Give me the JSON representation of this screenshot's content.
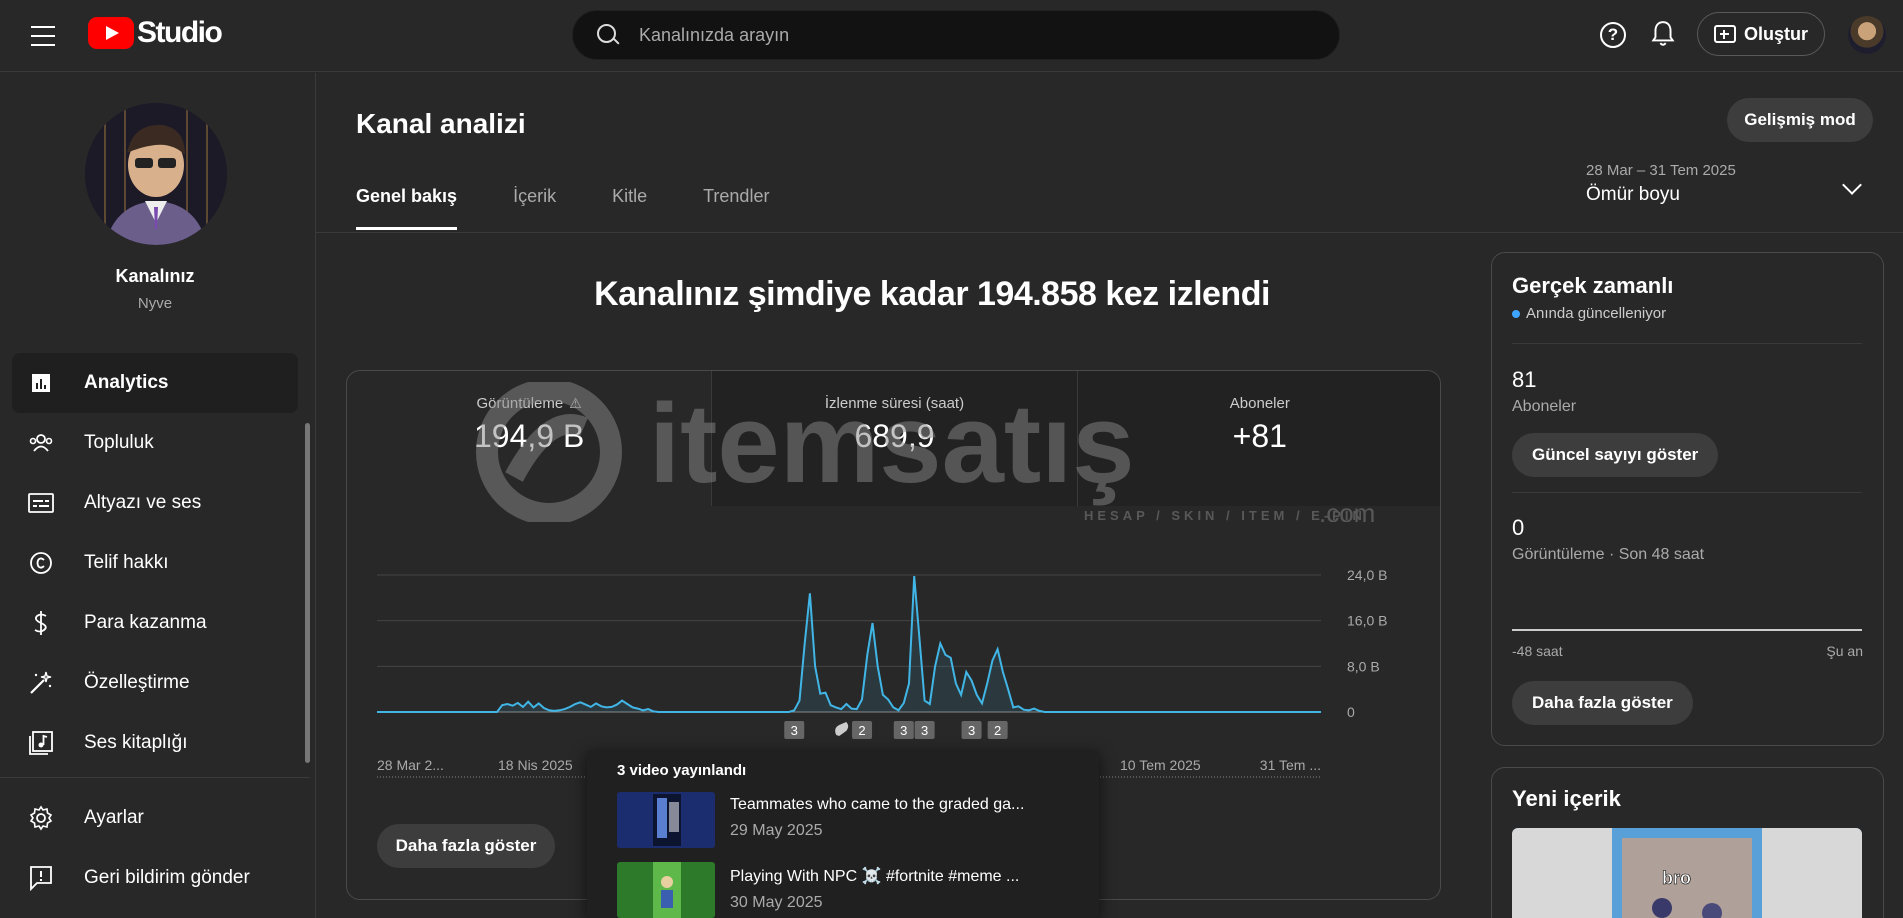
{
  "app": {
    "logo_text": "Studio"
  },
  "search": {
    "placeholder": "Kanalınızda arayın"
  },
  "header": {
    "help_symbol": "?",
    "create_label": "Oluştur"
  },
  "sidebar": {
    "channel_label": "Kanalınız",
    "channel_handle": "Nyve",
    "items": [
      {
        "label": "Analytics",
        "icon": "analytics-icon",
        "active": true
      },
      {
        "label": "Topluluk",
        "icon": "community-icon"
      },
      {
        "label": "Altyazı ve ses",
        "icon": "subtitles-icon"
      },
      {
        "label": "Telif hakkı",
        "icon": "copyright-icon"
      },
      {
        "label": "Para kazanma",
        "icon": "dollar-icon"
      },
      {
        "label": "Özelleştirme",
        "icon": "magic-wand-icon"
      },
      {
        "label": "Ses kitaplığı",
        "icon": "audio-library-icon"
      }
    ],
    "bottom_items": [
      {
        "label": "Ayarlar",
        "icon": "gear-icon"
      },
      {
        "label": "Geri bildirim gönder",
        "icon": "feedback-icon"
      }
    ]
  },
  "main": {
    "title": "Kanal analizi",
    "advanced_mode_label": "Gelişmiş mod",
    "tabs": [
      {
        "label": "Genel bakış",
        "active": true
      },
      {
        "label": "İçerik"
      },
      {
        "label": "Kitle"
      },
      {
        "label": "Trendler"
      }
    ],
    "date_range": "28 Mar – 31 Tem 2025",
    "date_label": "Ömür boyu",
    "headline": "Kanalınız şimdiye kadar 194.858 kez izlendi",
    "metrics": [
      {
        "label": "Görüntüleme",
        "value": "194,9 B",
        "warning": true
      },
      {
        "label": "İzlenme süresi (saat)",
        "value": "689,9"
      },
      {
        "label": "Aboneler",
        "value": "+81"
      }
    ],
    "show_more_label": "Daha fazla göster",
    "watermark": {
      "brand": "itemsatış",
      "tagline": "HESAP / SKIN / ITEM / E-PIN",
      "suffix": ".com"
    }
  },
  "chart_data": {
    "type": "line",
    "x_tick_labels": [
      "28 Mar 2...",
      "18 Nis 2025",
      "10 Tem 2025",
      "31 Tem ..."
    ],
    "y_tick_labels": [
      "24,0 B",
      "16,0 B",
      "8,0 B",
      "0"
    ],
    "ylim": [
      0,
      24000
    ],
    "series": [
      {
        "values": [
          0,
          0,
          0,
          0,
          0,
          0,
          0,
          0,
          0,
          0,
          0,
          0,
          0,
          0,
          0,
          0,
          0,
          0,
          0,
          0,
          0,
          0,
          0,
          0,
          1200,
          1400,
          1100,
          1600,
          900,
          1800,
          800,
          1500,
          700,
          300,
          200,
          300,
          500,
          900,
          1400,
          1700,
          1300,
          900,
          1500,
          1000,
          800,
          900,
          1300,
          2000,
          1400,
          800,
          600,
          300,
          500,
          100,
          0,
          0,
          0,
          0,
          0,
          0,
          0,
          0,
          0,
          0,
          0,
          0,
          0,
          0,
          0,
          0,
          0,
          0,
          0,
          0,
          0,
          0,
          0,
          0,
          0,
          0,
          300,
          2000,
          12000,
          20800,
          8000,
          3200,
          3400,
          1200,
          800,
          500,
          1400,
          600,
          500,
          2200,
          10000,
          15600,
          8000,
          3000,
          2200,
          800,
          300,
          1600,
          5000,
          23800,
          13000,
          2000,
          1400,
          8000,
          12000,
          10000,
          9500,
          5000,
          3000,
          7000,
          5500,
          3000,
          1500,
          5000,
          9000,
          11000,
          7000,
          4000,
          800,
          1000,
          400,
          300,
          600,
          200,
          0,
          0,
          0,
          0,
          0,
          0,
          0,
          0,
          0,
          0,
          0,
          0,
          0,
          0,
          0,
          0,
          0,
          0,
          0,
          0,
          0,
          0,
          0,
          0,
          0,
          0,
          0,
          0,
          0,
          0,
          0,
          0,
          0,
          0,
          0,
          0,
          0,
          0,
          0,
          0,
          0,
          0,
          0,
          0,
          0,
          0,
          0,
          0,
          0,
          0,
          0,
          0,
          0,
          0
        ]
      }
    ],
    "upload_markers": [
      {
        "label": "3",
        "index": 80
      },
      {
        "label": "shorts",
        "index": 89
      },
      {
        "label": "2",
        "index": 93
      },
      {
        "label": "3",
        "index": 101
      },
      {
        "label": "3",
        "index": 105
      },
      {
        "label": "3",
        "index": 114
      },
      {
        "label": "2",
        "index": 119
      }
    ]
  },
  "popup": {
    "title": "3 video yayınlandı",
    "videos": [
      {
        "title": "Teammates who came to the graded ga...",
        "date": "29 May 2025"
      },
      {
        "title": "Playing With NPC ☠️ #fortnite #meme ...",
        "date": "30 May 2025"
      }
    ]
  },
  "realtime": {
    "title": "Gerçek zamanlı",
    "live_label": "Anında güncelleniyor",
    "subscribers_value": "81",
    "subscribers_label": "Aboneler",
    "show_count_label": "Güncel sayıyı göster",
    "views_value": "0",
    "views_label": "Görüntüleme · Son 48 saat",
    "axis_left": "-48 saat",
    "axis_right": "Şu an",
    "show_more_label": "Daha fazla göster"
  },
  "new_content": {
    "title": "Yeni içerik",
    "thumb_text": "bro"
  },
  "colors": {
    "accent": "#3ea6ff",
    "line": "#41b6e6",
    "brand_red": "#ff0000",
    "background": "#282828"
  }
}
